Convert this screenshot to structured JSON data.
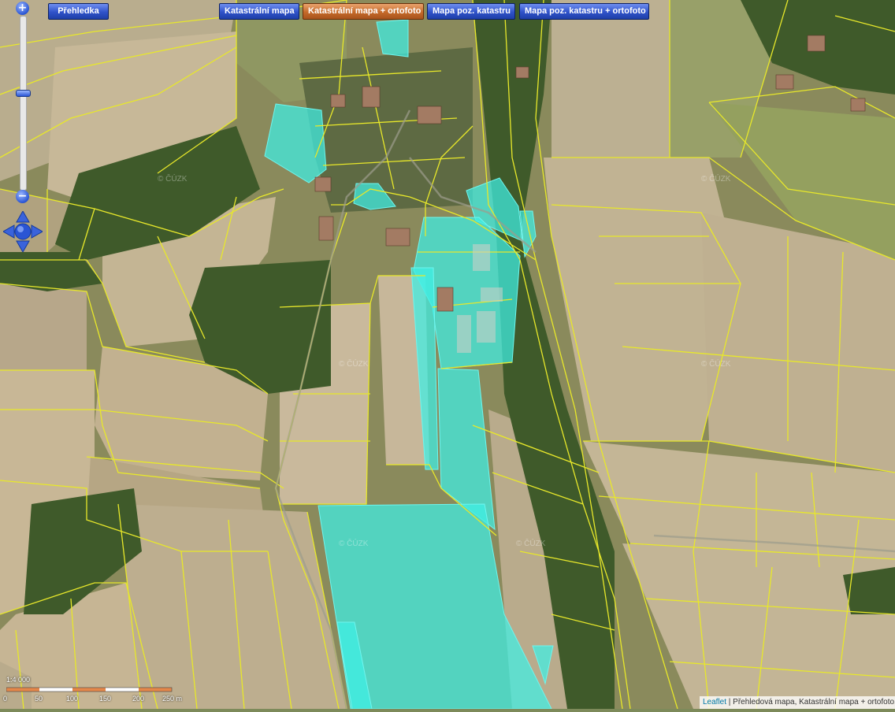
{
  "toolbar": {
    "overview_label": "Přehledka",
    "layers": [
      {
        "label": "Katastrální mapa",
        "active": false
      },
      {
        "label": "Katastrální mapa + ortofoto",
        "active": true
      },
      {
        "label": "Mapa poz. katastru",
        "active": false
      },
      {
        "label": "Mapa poz. katastru + ortofoto",
        "active": false
      }
    ]
  },
  "zoom": {
    "in_label": "+",
    "out_label": "−",
    "level_fraction": 0.44
  },
  "pan_icon": "pan-compass-icon",
  "scale": {
    "ratio": "1:4 000",
    "ticks": [
      "0",
      "50",
      "100",
      "150",
      "200",
      "250 m"
    ]
  },
  "attribution": {
    "link_label": "Leaflet",
    "text": " | Přehledová mapa, Katastrální mapa + ortofoto, Č"
  },
  "watermark": "© ČÚZK",
  "colors": {
    "parcel_line": "#e8e82a",
    "highlight_fill": "#3ff0e6",
    "active_button": "#c56a2a",
    "button": "#2f52c9"
  }
}
